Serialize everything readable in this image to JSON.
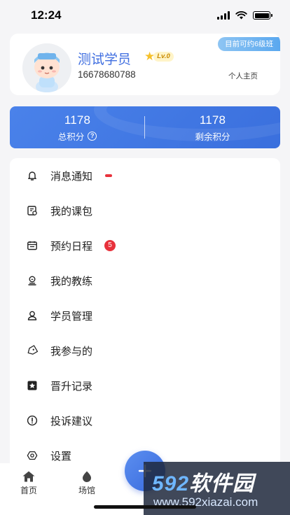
{
  "status_bar": {
    "time": "12:24"
  },
  "profile": {
    "level_tag": "目前可约6级班",
    "name": "测试学员",
    "level_badge": "Lv.0",
    "phone": "16678680788",
    "home_link": "个人主页"
  },
  "points": {
    "total_value": "1178",
    "total_label": "总积分",
    "remaining_value": "1178",
    "remaining_label": "剩余积分"
  },
  "menu": {
    "items": [
      {
        "label": "消息通知",
        "icon": "bell-icon",
        "indicator": "dot"
      },
      {
        "label": "我的课包",
        "icon": "course-package-icon"
      },
      {
        "label": "预约日程",
        "icon": "calendar-icon",
        "badge": "5"
      },
      {
        "label": "我的教练",
        "icon": "coach-icon"
      },
      {
        "label": "学员管理",
        "icon": "user-icon"
      },
      {
        "label": "我参与的",
        "icon": "tag-icon"
      },
      {
        "label": "晋升记录",
        "icon": "star-icon"
      },
      {
        "label": "投诉建议",
        "icon": "alert-icon"
      },
      {
        "label": "设置",
        "icon": "settings-icon"
      }
    ]
  },
  "tab_bar": {
    "tabs": [
      {
        "label": "首页",
        "icon": "home-icon"
      },
      {
        "label": "场馆",
        "icon": "venue-icon"
      }
    ]
  },
  "watermark": {
    "brand_num": "592",
    "brand_text": "软件园",
    "url": "www.592xiazai.com"
  },
  "colors": {
    "accent": "#3f6ee0",
    "card_blue": "#4a82ea",
    "badge_red": "#e8323c",
    "level_tag": "#6ab2f0"
  }
}
